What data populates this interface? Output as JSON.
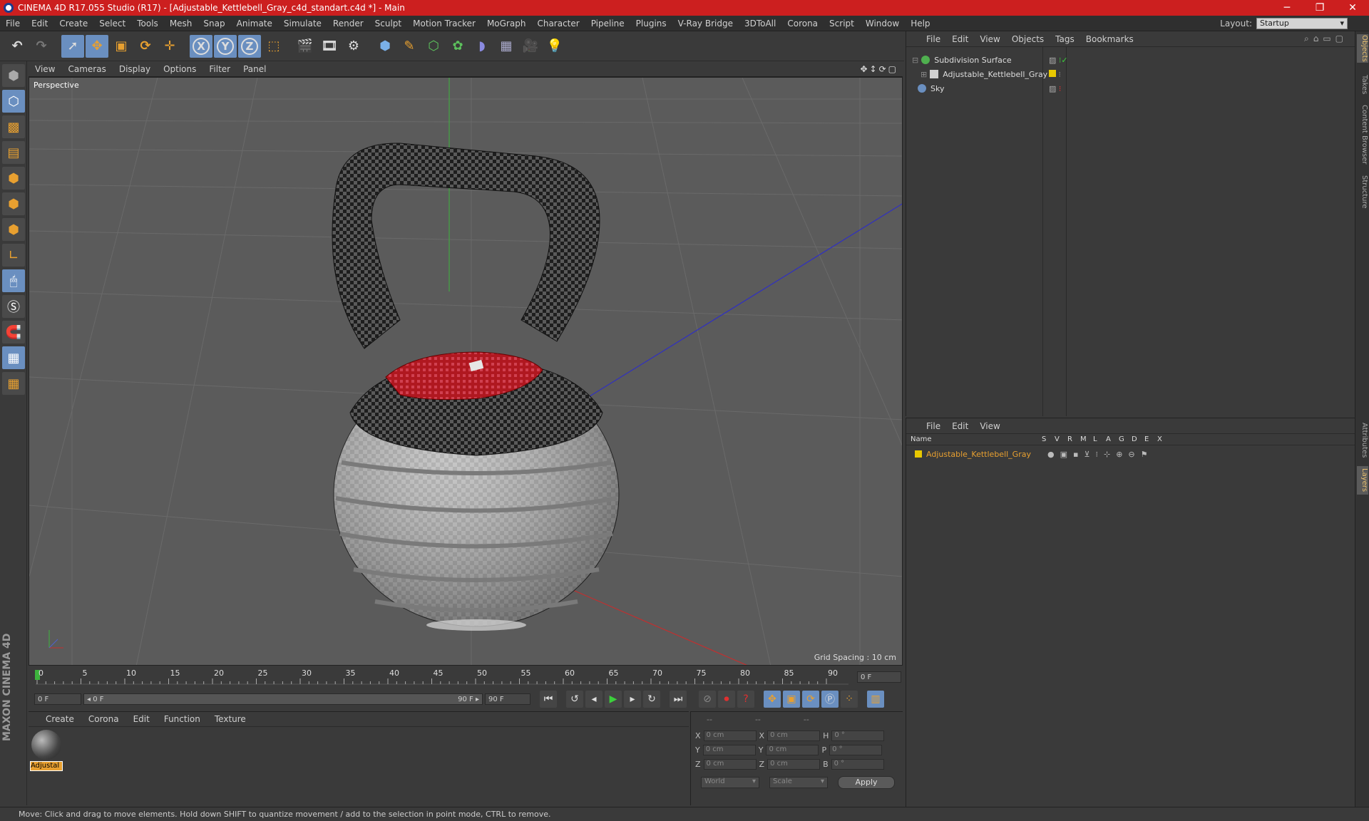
{
  "window": {
    "title": "CINEMA 4D R17.055 Studio (R17) - [Adjustable_Kettlebell_Gray_c4d_standart.c4d *] - Main",
    "minimize": "─",
    "maximize": "❐",
    "close": "✕"
  },
  "menu": [
    "File",
    "Edit",
    "Create",
    "Select",
    "Tools",
    "Mesh",
    "Snap",
    "Animate",
    "Simulate",
    "Render",
    "Sculpt",
    "Motion Tracker",
    "MoGraph",
    "Character",
    "Pipeline",
    "Plugins",
    "V-Ray Bridge",
    "3DToAll",
    "Corona",
    "Script",
    "Window",
    "Help"
  ],
  "layout": {
    "label": "Layout:",
    "value": "Startup"
  },
  "viewport": {
    "menu": [
      "View",
      "Cameras",
      "Display",
      "Options",
      "Filter",
      "Panel"
    ],
    "label": "Perspective",
    "grid_spacing": "Grid Spacing : 10 cm",
    "nav_icons": "✥↕⟳▢"
  },
  "timeline": {
    "ticks": [
      "0",
      "5",
      "10",
      "15",
      "20",
      "25",
      "30",
      "35",
      "40",
      "45",
      "50",
      "55",
      "60",
      "65",
      "70",
      "75",
      "80",
      "85",
      "90"
    ],
    "end_field": "0 F",
    "start_field": "0 F",
    "range_start": "◂ 0 F",
    "range_end": "90 F ▸",
    "max_field": "90 F"
  },
  "material_panel": {
    "menu": [
      "Create",
      "Corona",
      "Edit",
      "Function",
      "Texture"
    ],
    "material_name": "Adjustal"
  },
  "coords": {
    "header": [
      "--",
      "--",
      "--"
    ],
    "rows": [
      {
        "a": "X",
        "av": "0 cm",
        "b": "X",
        "bv": "0 cm",
        "c": "H",
        "cv": "0 °"
      },
      {
        "a": "Y",
        "av": "0 cm",
        "b": "Y",
        "bv": "0 cm",
        "c": "P",
        "cv": "0 °"
      },
      {
        "a": "Z",
        "av": "0 cm",
        "b": "Z",
        "bv": "0 cm",
        "c": "B",
        "cv": "0 °"
      }
    ],
    "mode1": "World",
    "mode2": "Scale",
    "apply": "Apply"
  },
  "objects_panel": {
    "menu": [
      "File",
      "Edit",
      "View",
      "Objects",
      "Tags",
      "Bookmarks"
    ],
    "items": [
      {
        "name": "Subdivision Surface",
        "icon_color": "#4fb04f"
      },
      {
        "name": "Adjustable_Kettlebell_Gray",
        "icon_color": "#d0d0d0"
      },
      {
        "name": "Sky",
        "icon_color": "#6a8fc0"
      }
    ]
  },
  "layers_panel": {
    "menu": [
      "File",
      "Edit",
      "View"
    ],
    "columns": [
      "Name",
      "S",
      "V",
      "R",
      "M",
      "L",
      "A",
      "G",
      "D",
      "E",
      "X"
    ],
    "layer_name": "Adjustable_Kettlebell_Gray",
    "layer_color": "#e8c800"
  },
  "right_tabs": [
    "Objects",
    "Takes",
    "Content Browser",
    "Structure",
    "Attributes",
    "Layers"
  ],
  "status": "Move: Click and drag to move elements. Hold down SHIFT to quantize movement / add to the selection in point mode, CTRL to remove.",
  "brand": "MAXON CINEMA 4D"
}
